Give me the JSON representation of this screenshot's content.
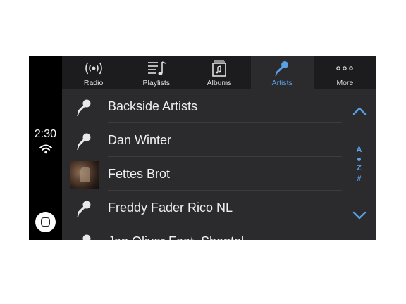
{
  "status": {
    "time": "2:30"
  },
  "tabs": [
    {
      "label": "Radio",
      "icon": "radio-icon",
      "active": false
    },
    {
      "label": "Playlists",
      "icon": "playlists-icon",
      "active": false
    },
    {
      "label": "Albums",
      "icon": "albums-icon",
      "active": false
    },
    {
      "label": "Artists",
      "icon": "microphone-icon",
      "active": true
    },
    {
      "label": "More",
      "icon": "more-icon",
      "active": false
    }
  ],
  "artists": [
    {
      "name": "Backside Artists",
      "icon": "microphone-icon"
    },
    {
      "name": "Dan Winter",
      "icon": "microphone-icon"
    },
    {
      "name": "Fettes Brot",
      "icon": "artist-photo"
    },
    {
      "name": "Freddy Fader  Rico NL",
      "icon": "microphone-icon"
    },
    {
      "name": "Jan Oliver Feat. Shantel",
      "icon": "microphone-icon"
    }
  ],
  "index": {
    "top": "A",
    "middle": "Z",
    "bottom": "#"
  },
  "colors": {
    "accent": "#5aa0e6",
    "background": "#2b2b2d",
    "tabbar": "#1c1c1e",
    "status": "#000000"
  }
}
